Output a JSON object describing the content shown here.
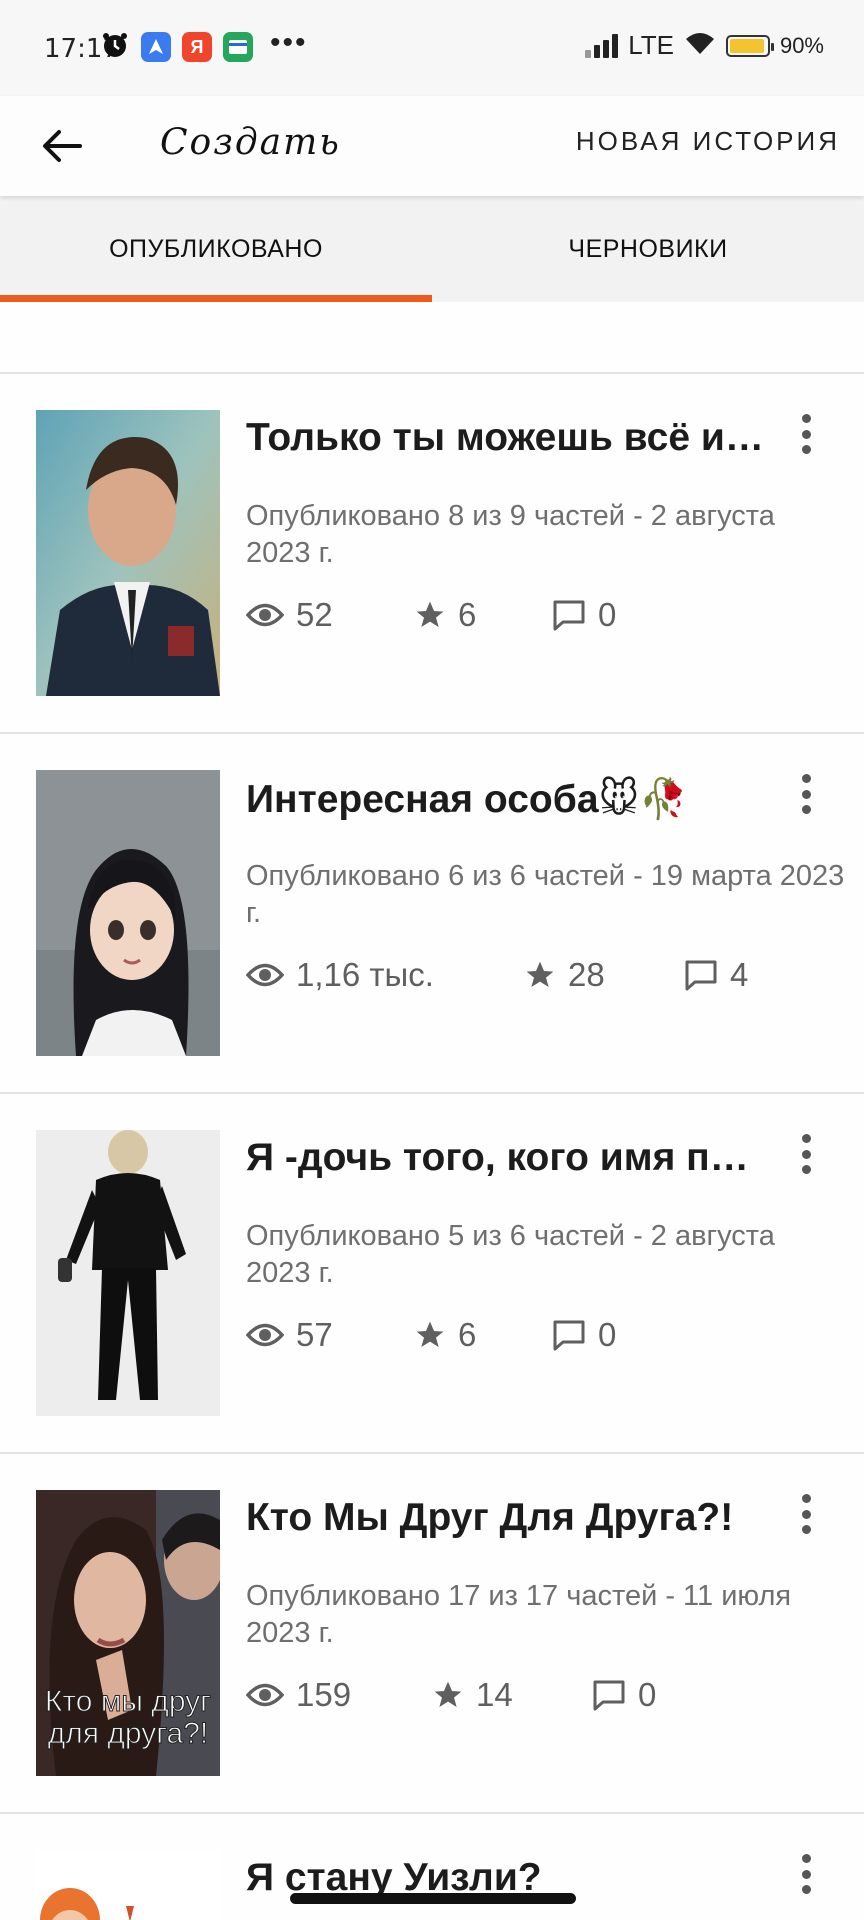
{
  "status_bar": {
    "time": "17:17",
    "network": "LTE",
    "battery": "90%",
    "battery_level": 0.9
  },
  "app_bar": {
    "title": "Создать",
    "action": "НОВАЯ ИСТОРИЯ"
  },
  "tabs": [
    {
      "label": "ОПУБЛИКОВАНО",
      "selected": true
    },
    {
      "label": "ЧЕРНОВИКИ",
      "selected": false
    }
  ],
  "stories": [
    {
      "title": "Только ты можешь всё ис...",
      "published": "Опубликовано 8 из 9 частей - 2 августа 2023 г.",
      "views": "52",
      "stars": "6",
      "comments": "0"
    },
    {
      "title": "Интересная особа🐭🥀",
      "published": "Опубликовано 6 из 6 частей - 19 марта 2023 г.",
      "views": "1,16 тыс.",
      "stars": "28",
      "comments": "4"
    },
    {
      "title": "Я -дочь того, кого имя про...",
      "published": "Опубликовано 5 из 6 частей - 2 августа 2023 г.",
      "views": "57",
      "stars": "6",
      "comments": "0"
    },
    {
      "title": "Кто Мы Друг Для Друга?!",
      "published": "Опубликовано 17 из 17 частей - 11 июля 2023 г.",
      "views": "159",
      "stars": "14",
      "comments": "0",
      "cover_text": "Кто мы друг для друга?!"
    },
    {
      "title": "Я стану Уизли?"
    }
  ],
  "colors": {
    "accent": "#ee5b1c"
  }
}
